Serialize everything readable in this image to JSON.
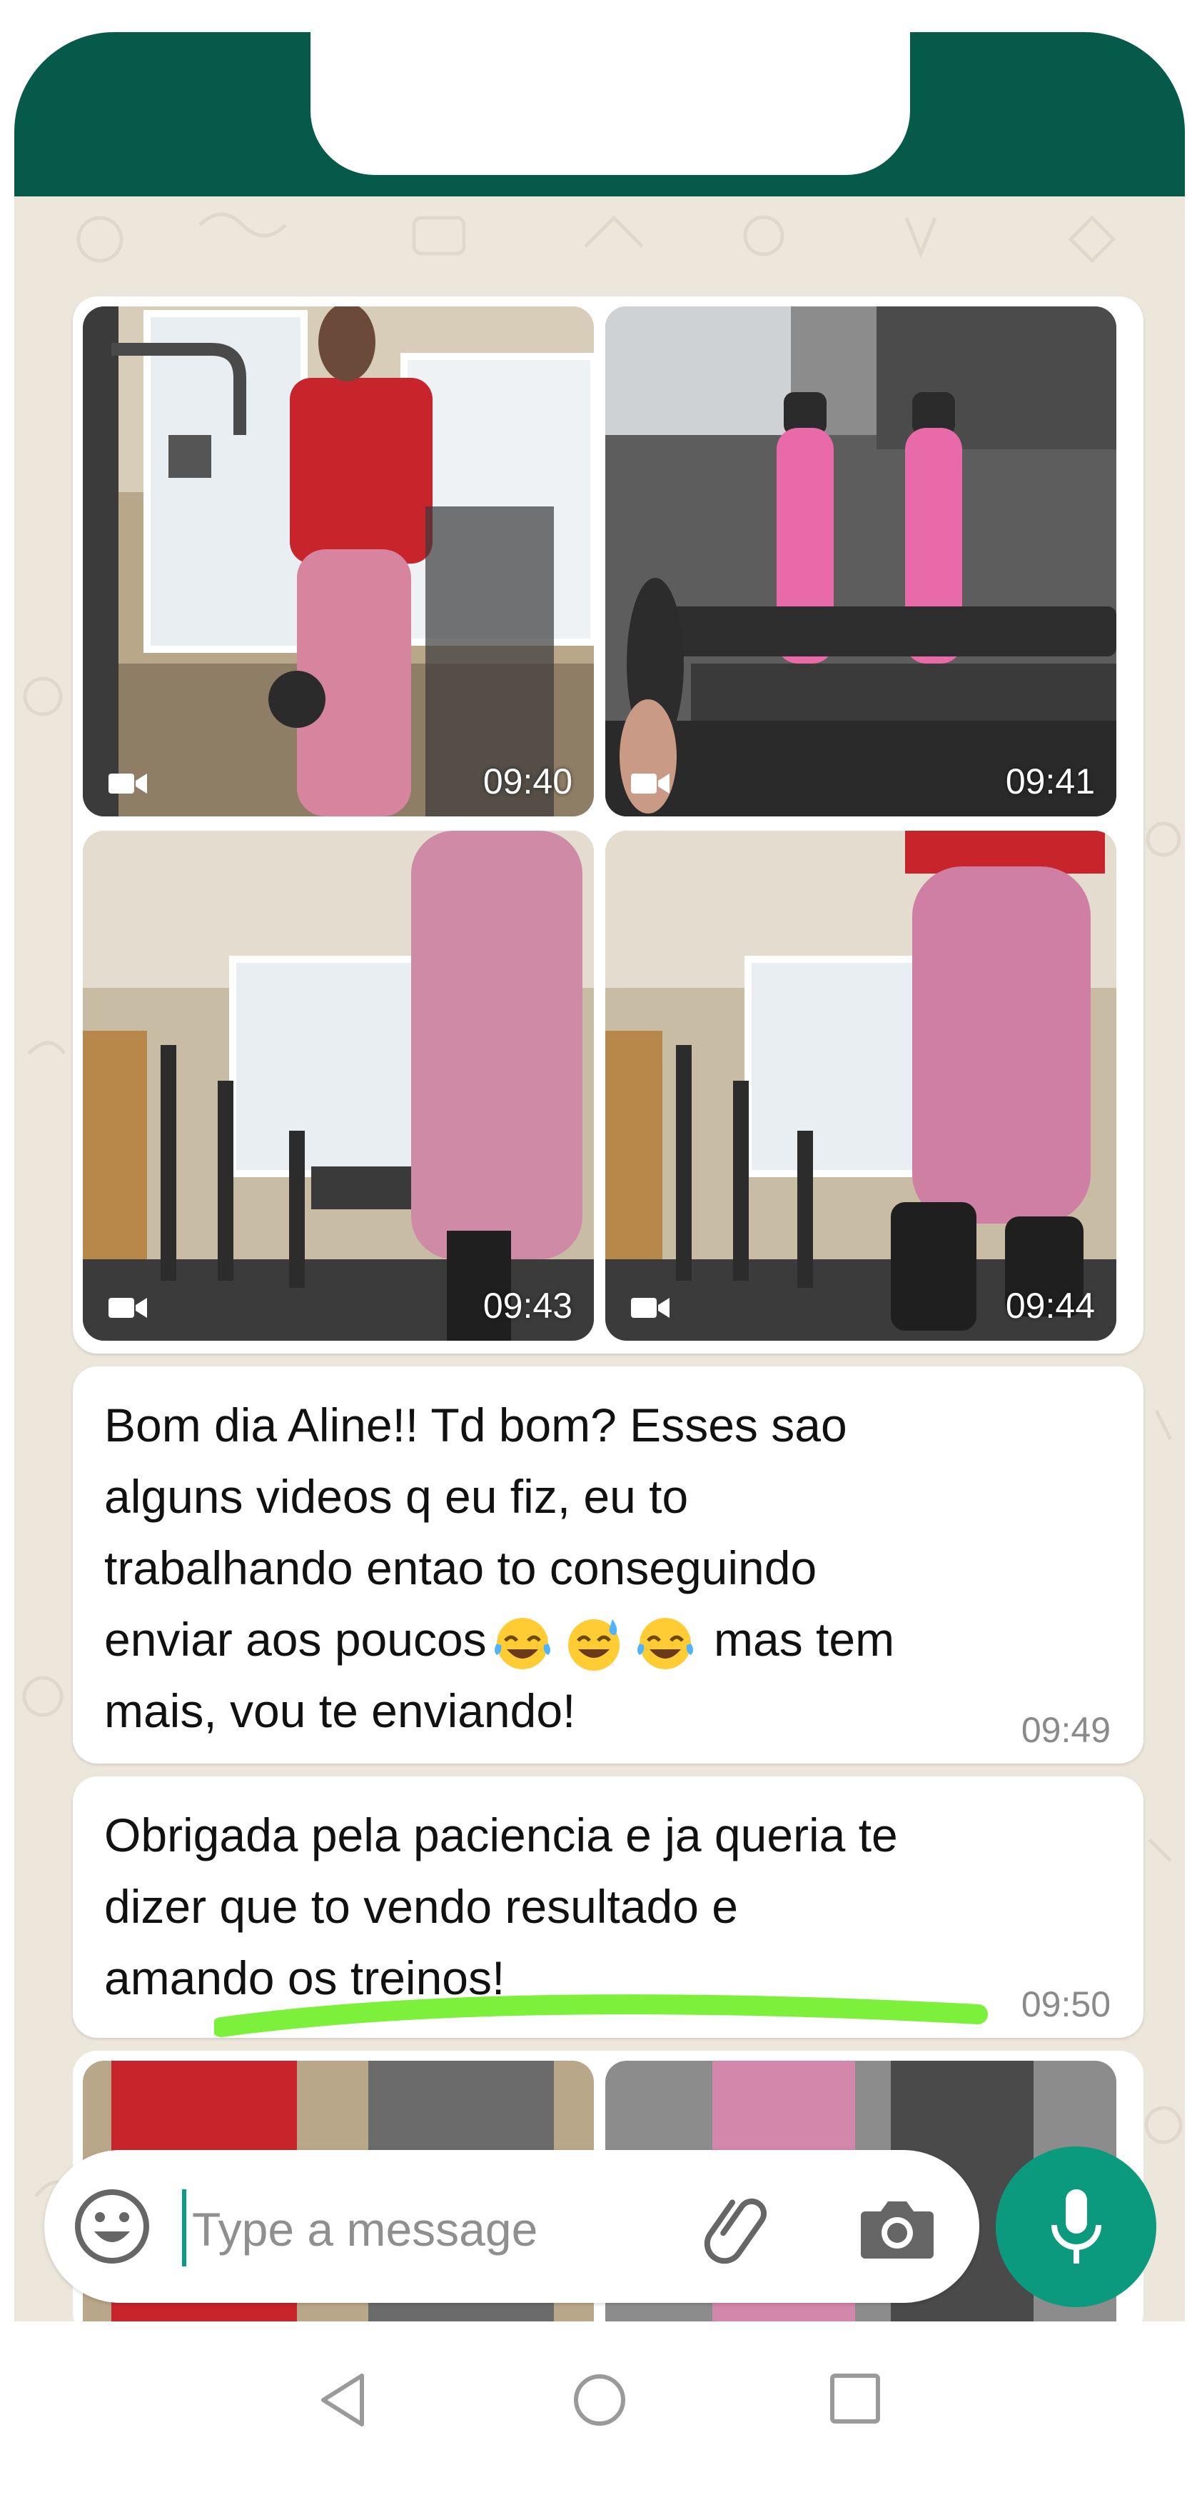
{
  "chat": {
    "videos": [
      {
        "time": "09:40"
      },
      {
        "time": "09:41"
      },
      {
        "time": "09:43"
      },
      {
        "time": "09:44"
      }
    ],
    "messages": [
      {
        "text": "Bom dia Aline!! Td bom? Esses sao\nalguns videos q eu fiz, eu to\ntrabalhando entao to conseguindo\nenviar aos poucos",
        "emojis": [
          "tears-of-joy-emoji",
          "sweat-smile-emoji",
          "tears-of-joy-emoji"
        ],
        "text_after_emojis": " mas tem\nmais, vou te enviando!",
        "time": "09:49"
      },
      {
        "text": "Obrigada pela paciencia e ja queria te\ndizer que to vendo resultado e\namando os treinos!",
        "time": "09:50"
      }
    ]
  },
  "composer": {
    "placeholder": "Type a message",
    "icons": [
      "emoji-icon",
      "paperclip-icon",
      "camera-icon",
      "microphone-icon"
    ]
  },
  "navigation": {
    "icons": [
      "back-icon",
      "home-icon",
      "recent-apps-icon"
    ]
  },
  "colors": {
    "header": "#055a4a",
    "chat_background": "#ede6db",
    "mic_button": "#0c9a7e",
    "highlight": "#7cf03a"
  }
}
